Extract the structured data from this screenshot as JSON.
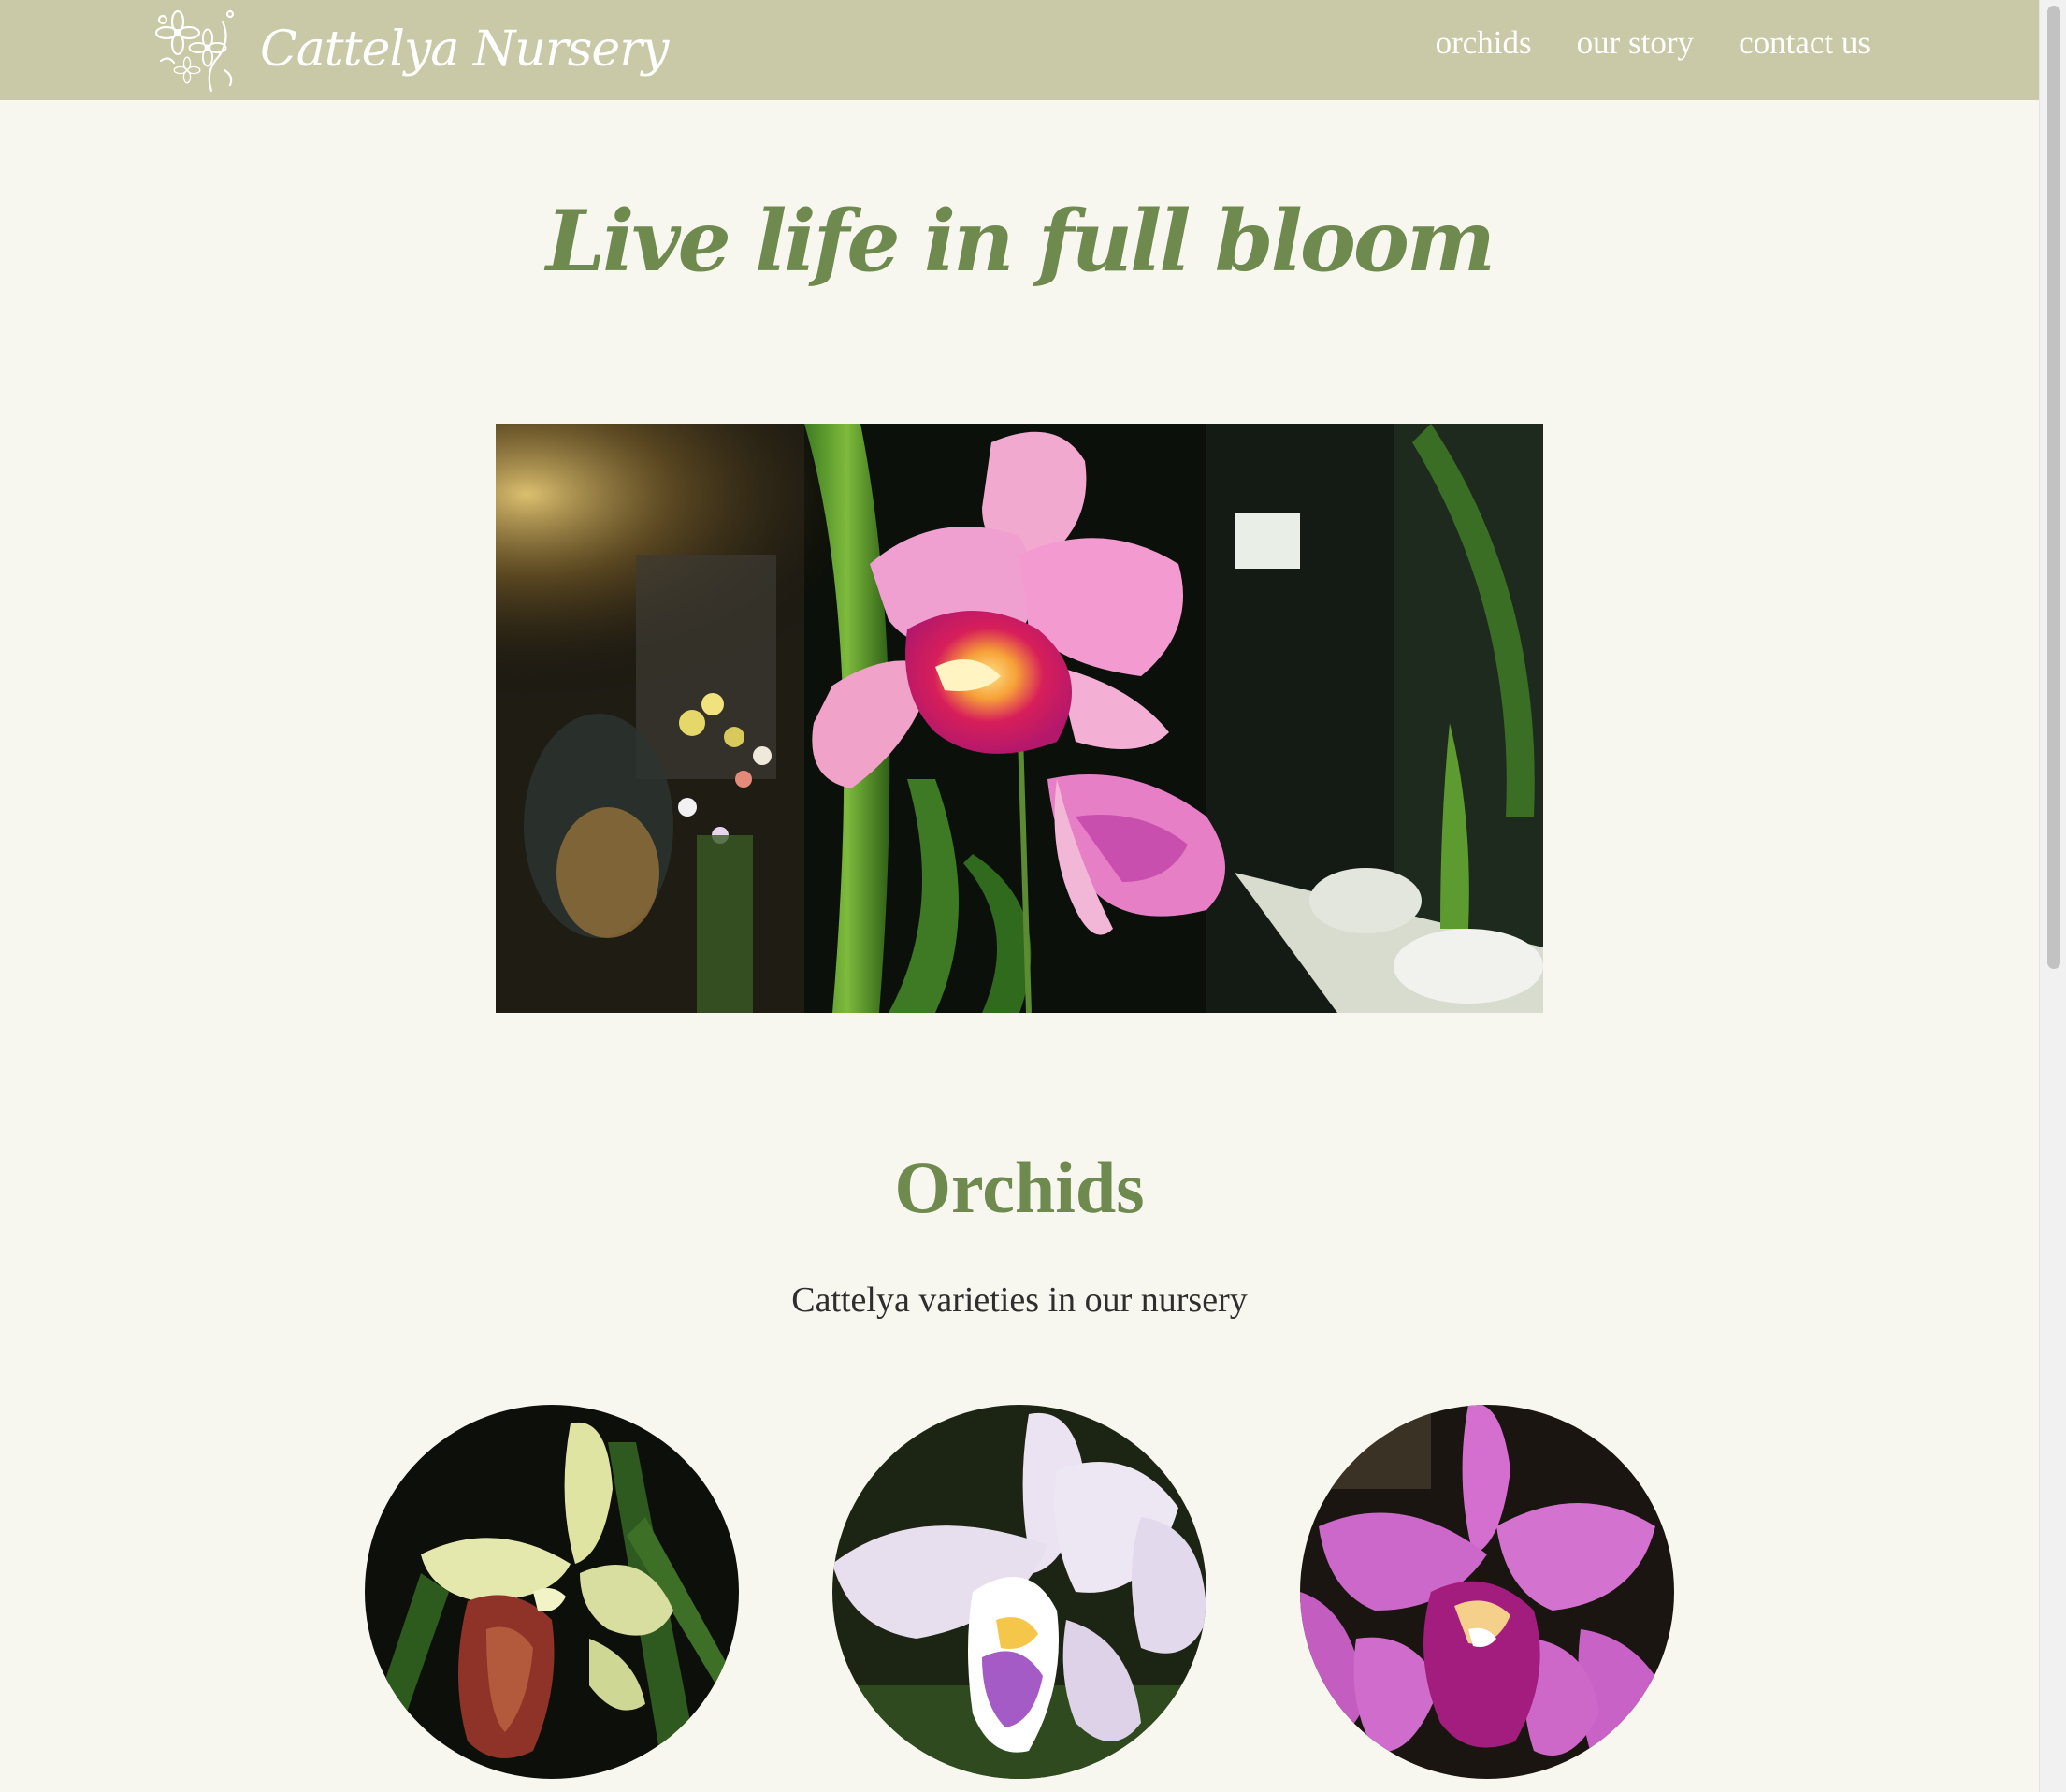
{
  "header": {
    "brand_name": "Cattelya Nursery",
    "nav": [
      {
        "label": "orchids"
      },
      {
        "label": "our story"
      },
      {
        "label": "contact us"
      }
    ]
  },
  "hero": {
    "title": "Live life in full bloom"
  },
  "orchids": {
    "title": "Orchids",
    "subtitle": "Cattelya varieties in our nursery"
  },
  "colors": {
    "header_bg": "#c9c8a7",
    "page_bg": "#f8f7ef",
    "accent_green": "#6f8a4e",
    "body_text": "#2e2e2e"
  },
  "icons": {
    "logo": "orchid-flower-icon"
  }
}
